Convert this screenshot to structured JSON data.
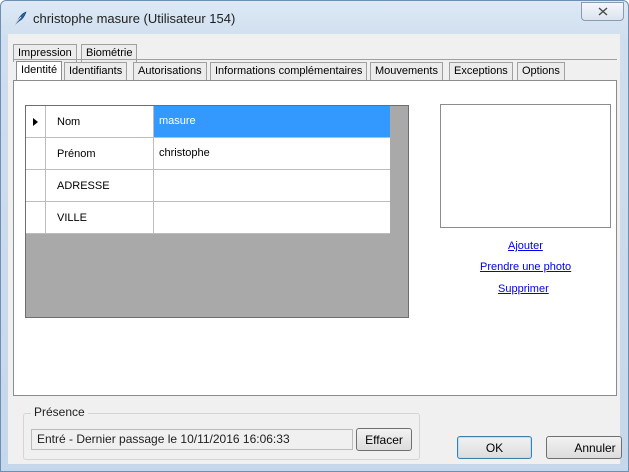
{
  "window": {
    "title": "christophe masure (Utilisateur 154)"
  },
  "tabs_top": [
    {
      "label": "Impression"
    },
    {
      "label": "Biométrie"
    }
  ],
  "tabs": [
    {
      "label": "Identité",
      "active": true
    },
    {
      "label": "Identifiants"
    },
    {
      "label": "Autorisations"
    },
    {
      "label": "Informations complémentaires"
    },
    {
      "label": "Mouvements"
    },
    {
      "label": "Exceptions"
    },
    {
      "label": "Options"
    }
  ],
  "grid": {
    "rows": [
      {
        "name": "Nom",
        "value": "masure",
        "selected": true
      },
      {
        "name": "Prénom",
        "value": "christophe"
      },
      {
        "name": "ADRESSE",
        "value": ""
      },
      {
        "name": "VILLE",
        "value": ""
      }
    ]
  },
  "photo": {
    "links": {
      "add": "Ajouter",
      "take": "Prendre une photo",
      "delete": "Supprimer"
    }
  },
  "presence": {
    "group_label": "Présence",
    "status": "Entré - Dernier passage le 10/11/2016 16:06:33",
    "clear_label": "Effacer"
  },
  "buttons": {
    "ok": "OK",
    "cancel": "Annuler"
  },
  "colors": {
    "selection": "#3399ff",
    "link": "#0000ee",
    "grid_background": "#a9a9a9"
  },
  "icons": {
    "app": "pen-feather-icon",
    "close": "close-icon",
    "current_row": "row-pointer-icon"
  }
}
